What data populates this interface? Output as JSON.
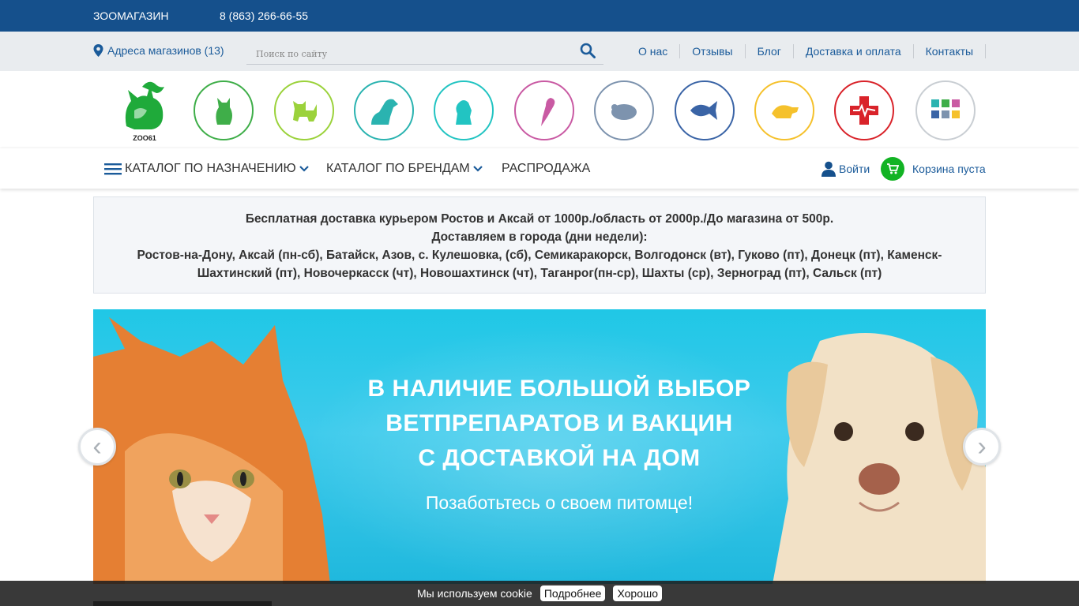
{
  "topbar": {
    "shop_label": "ЗООМАГАЗИН",
    "phone": "8 (863) 266-66-55"
  },
  "bar2": {
    "stores_link": "Адреса магазинов (13)",
    "search_placeholder": "Поиск по сайту",
    "nav": [
      "О нас",
      "Отзывы",
      "Блог",
      "Доставка и оплата",
      "Контакты"
    ]
  },
  "logo": {
    "text": "ZOO61"
  },
  "categories": [
    {
      "icon": "cat-icon",
      "color": "#3fae49"
    },
    {
      "icon": "kitten-icon",
      "color": "#9bd23b"
    },
    {
      "icon": "dog-icon",
      "color": "#2ab3b0"
    },
    {
      "icon": "puppy-icon",
      "color": "#22c4c2"
    },
    {
      "icon": "parrot-icon",
      "color": "#c95aa3"
    },
    {
      "icon": "rodent-icon",
      "color": "#7d93ae"
    },
    {
      "icon": "fish-icon",
      "color": "#3a64a6"
    },
    {
      "icon": "turtle-icon",
      "color": "#f5c12c"
    },
    {
      "icon": "vet-cross-icon",
      "color": "#d9232a"
    },
    {
      "icon": "grid-icon",
      "color": "#c9ced3"
    }
  ],
  "mainnav": {
    "catalog_purpose": "КАТАЛОГ ПО НАЗНАЧЕНИЮ",
    "catalog_brands": "КАТАЛОГ ПО БРЕНДАМ",
    "sale": "РАСПРОДАЖА",
    "login": "Войти",
    "cart": "Корзина пуста"
  },
  "delivery": {
    "line1": "Бесплатная доставка курьером Ростов и Аксай от 1000р./область от 2000р./До магазина от 500р.",
    "line2": "Доставляем в города (дни недели):",
    "line3": "Ростов-на-Дону, Аксай (пн-сб), Батайск, Азов, с. Кулешовка, (сб), Семикаракорск, Волгодонск (вт), Гуково (пт), Донецк (пт), Каменск-Шахтинский (пт), Новочеркасск (чт), Новошахтинск (чт), Таганрог(пн-ср), Шахты (ср), Зерноград (пт), Сальск (пт)"
  },
  "banner": {
    "line1": "В НАЛИЧИЕ БОЛЬШОЙ ВЫБОР",
    "line2": "ВЕТПРЕПАРАТОВ И ВАКЦИН",
    "line3": "С ДОСТАВКОЙ НА ДОМ",
    "line4": "Позаботьтесь о своем питомце!"
  },
  "slider": {
    "prev": "‹",
    "next": "›"
  },
  "cookie": {
    "text": "Мы используем cookie",
    "more": "Подробнее",
    "ok": "Хорошо"
  },
  "colors": {
    "brand_blue": "#15508c",
    "link_blue": "#1b5b9a",
    "cart_green": "#12b324",
    "banner_cyan": "#20c7e6"
  }
}
